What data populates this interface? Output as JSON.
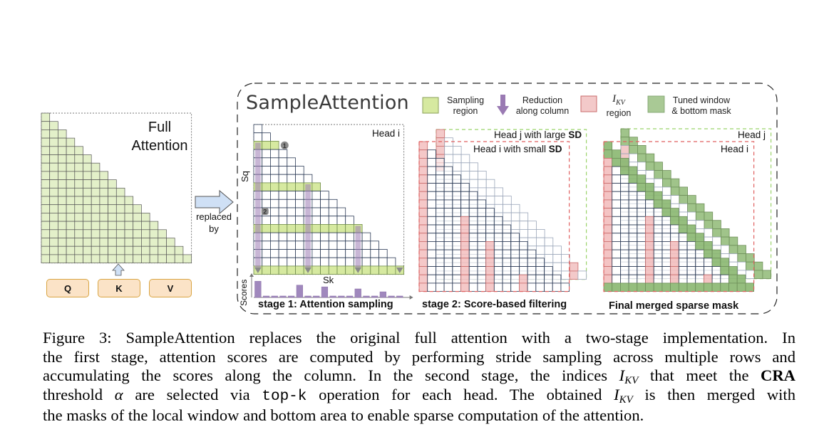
{
  "figure": {
    "full_attention": {
      "title_line1": "Full",
      "title_line2": "Attention",
      "grid_size": 18,
      "cell_color": "#e3f0c9",
      "inputs": [
        "Q",
        "K",
        "V"
      ],
      "input_fill": "#fbe3c7",
      "input_border": "#d9a441"
    },
    "replaced_by": {
      "line1": "replaced",
      "line2": "by",
      "arrow_fill": "#cfe0f5"
    },
    "sample_attention": {
      "title": "SampleAttention",
      "legend": [
        {
          "swatch": "#d6e9a0",
          "swatch_border": "#8aa05a",
          "line1": "Sampling",
          "line2": "region",
          "icon": "square"
        },
        {
          "swatch": "#9a7ab3",
          "line1": "Reduction",
          "line2": "along column",
          "icon": "down-arrow"
        },
        {
          "swatch": "#f3c9c9",
          "swatch_border": "#c96b6b",
          "line1": "I_KV",
          "line2": "region",
          "icon": "square",
          "math": true,
          "math_base": "I",
          "math_sub": "KV"
        },
        {
          "swatch": "#a9c995",
          "swatch_border": "#7aa06a",
          "line1": "Tuned window",
          "line2": "& bottom mask",
          "icon": "square"
        }
      ],
      "stage1": {
        "title": "stage 1: Attention sampling",
        "head_label": "Head i",
        "axis_y": "Sq",
        "axis_x": "Sk",
        "scores_label": "Scores",
        "markers": [
          "1",
          "2"
        ],
        "sampled_rows": [
          2,
          7,
          12,
          17
        ],
        "reduction_columns": [
          0,
          6,
          12,
          17
        ],
        "scores": [
          0.95,
          0.05,
          0.05,
          0.06,
          0.05,
          0.72,
          0.04,
          0.04,
          0.62,
          0.05,
          0.04,
          0.04,
          0.5,
          0.04,
          0.04,
          0.33,
          0.04,
          0.04
        ]
      },
      "stage2": {
        "title": "stage 2: Score-based filtering",
        "head_j_label": "Head j with large ",
        "head_i_label": "Head i with small ",
        "sd_label": "SD",
        "head_j_color": "#9bd36a",
        "head_i_color": "#e06060",
        "head_i_kv_columns": [
          0,
          5,
          8,
          12,
          15
        ],
        "head_j_kv_columns": [
          0,
          16
        ]
      },
      "final": {
        "title": "Final merged sparse mask",
        "head_j_label": "Head j",
        "head_i_label": "Head i"
      }
    }
  },
  "caption": {
    "lines": [
      [
        {
          "t": "Figure 3: SampleAttention replaces the original full attention with a two-stage implementation. In"
        }
      ],
      [
        {
          "t": "the first stage, attention scores are computed by performing stride sampling across multiple rows and"
        }
      ],
      [
        {
          "t": "accumulating the scores along the column. In the second stage, the indices "
        },
        {
          "t": "I",
          "style": "math",
          "sub": "KV"
        },
        {
          "t": " that meet the "
        },
        {
          "t": "CRA",
          "style": "bold"
        }
      ],
      [
        {
          "t": "threshold "
        },
        {
          "t": "α",
          "style": "math"
        },
        {
          "t": " are selected via "
        },
        {
          "t": "top-k",
          "style": "mono"
        },
        {
          "t": " operation for each head. The obtained "
        },
        {
          "t": "I",
          "style": "math",
          "sub": "KV"
        },
        {
          "t": " is then merged with"
        }
      ],
      [
        {
          "t": "the masks of the local window and bottom area to enable sparse computation of the attention."
        }
      ]
    ]
  }
}
